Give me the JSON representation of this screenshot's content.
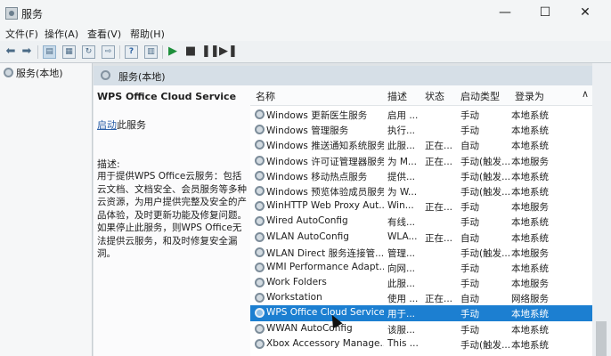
{
  "window": {
    "title": "服务",
    "controls": {
      "minimize": "—",
      "maximize": "☐",
      "close": "✕"
    }
  },
  "menubar": [
    "文件(F)",
    "操作(A)",
    "查看(V)",
    "帮助(H)"
  ],
  "toolbar": {
    "icons": [
      "back-arrow-icon",
      "forward-arrow-icon",
      "console-tree-icon",
      "properties-icon",
      "refresh-icon",
      "export-list-icon",
      "help-icon",
      "details-icon",
      "start-icon",
      "stop-icon",
      "pause-icon",
      "restart-icon"
    ]
  },
  "tree": {
    "item": "服务(本地)"
  },
  "banner": {
    "title": "服务(本地)"
  },
  "details": {
    "service_name": "WPS Office Cloud Service",
    "start_link": "启动",
    "start_suffix": "此服务",
    "desc_label": "描述:",
    "desc_text": "用于提供WPS Office云服务：包括云文档、文档安全、会员服务等多种云资源，为用户提供完整及安全的产品体验，及时更新功能及修复问题。如果停止此服务，则WPS Office无法提供云服务，和及时修复安全漏洞。"
  },
  "table": {
    "headers": {
      "name": "名称",
      "description": "描述",
      "status": "状态",
      "startup": "启动类型",
      "login": "登录为"
    },
    "rows": [
      {
        "name": "Windows 更新医生服务",
        "description": "启用 ...",
        "status": "",
        "startup": "手动",
        "login": "本地系统"
      },
      {
        "name": "Windows 管理服务",
        "description": "执行...",
        "status": "",
        "startup": "手动",
        "login": "本地系统"
      },
      {
        "name": "Windows 推送通知系统服务",
        "description": "此服...",
        "status": "正在...",
        "startup": "自动",
        "login": "本地系统"
      },
      {
        "name": "Windows 许可证管理器服务",
        "description": "为 M...",
        "status": "正在...",
        "startup": "手动(触发...",
        "login": "本地服务"
      },
      {
        "name": "Windows 移动热点服务",
        "description": "提供...",
        "status": "",
        "startup": "手动(触发...",
        "login": "本地系统"
      },
      {
        "name": "Windows 预览体验成员服务",
        "description": "为 W...",
        "status": "",
        "startup": "手动(触发...",
        "login": "本地系统"
      },
      {
        "name": "WinHTTP Web Proxy Aut...",
        "description": "Win...",
        "status": "正在...",
        "startup": "手动",
        "login": "本地服务"
      },
      {
        "name": "Wired AutoConfig",
        "description": "有线...",
        "status": "",
        "startup": "手动",
        "login": "本地系统"
      },
      {
        "name": "WLAN AutoConfig",
        "description": "WLA...",
        "status": "正在...",
        "startup": "自动",
        "login": "本地系统"
      },
      {
        "name": "WLAN Direct 服务连接管...",
        "description": "管理...",
        "status": "",
        "startup": "手动(触发...",
        "login": "本地服务"
      },
      {
        "name": "WMI Performance Adapt...",
        "description": "向网...",
        "status": "",
        "startup": "手动",
        "login": "本地系统"
      },
      {
        "name": "Work Folders",
        "description": "此服...",
        "status": "",
        "startup": "手动",
        "login": "本地服务"
      },
      {
        "name": "Workstation",
        "description": "使用 ...",
        "status": "正在...",
        "startup": "自动",
        "login": "网络服务"
      },
      {
        "name": "WPS Office Cloud Service",
        "description": "用于...",
        "status": "",
        "startup": "手动",
        "login": "本地系统",
        "selected": true
      },
      {
        "name": "WWAN AutoConfig",
        "description": "该服...",
        "status": "",
        "startup": "手动",
        "login": "本地系统"
      },
      {
        "name": "Xbox Accessory Manage...",
        "description": "This ...",
        "status": "",
        "startup": "手动(触发...",
        "login": "本地系统"
      }
    ]
  },
  "colors": {
    "selection": "#1c7fd1",
    "link": "#2b5fa8",
    "banner": "#d6dfe7"
  }
}
